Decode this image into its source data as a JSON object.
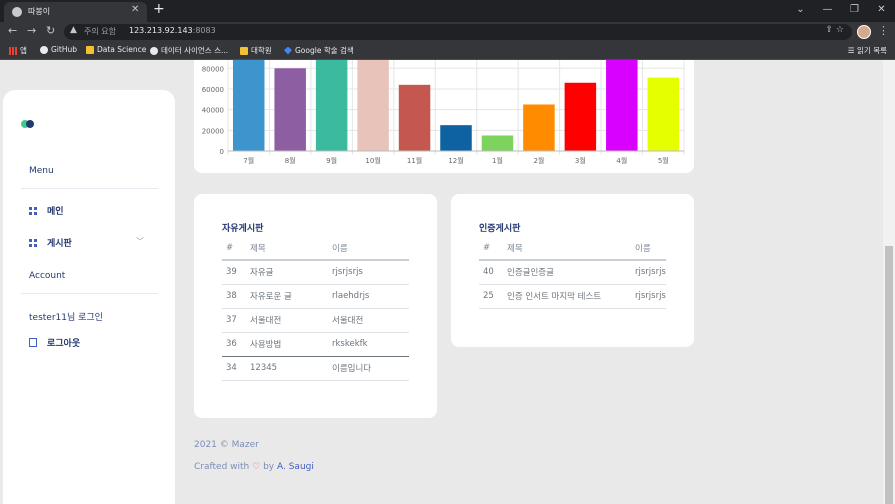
{
  "browser": {
    "tab_title": "따봉이",
    "tab_close": "✕",
    "new_tab": "+",
    "security_label": "주의 요함",
    "url_host": "123.213.92.143",
    "url_port": ":8083",
    "bookmarks": [
      "앱",
      "GitHub",
      "Data Science",
      "데이터 사이언스 스...",
      "대학원",
      "Google 학술 검색"
    ],
    "reading_list": "읽기 목록"
  },
  "sidebar": {
    "menu_title": "Menu",
    "items": [
      {
        "label": "메인"
      },
      {
        "label": "게시판"
      }
    ],
    "account_title": "Account",
    "login_text": "tester11님 로그인",
    "logout_label": "로그아웃"
  },
  "chart_data": {
    "type": "bar",
    "categories": [
      "7월",
      "8월",
      "9월",
      "10월",
      "11월",
      "12월",
      "1월",
      "2월",
      "3월",
      "4월",
      "5월"
    ],
    "values": [
      88000,
      80000,
      88000,
      88000,
      64000,
      25000,
      15000,
      45000,
      66000,
      88000,
      71000
    ],
    "colors": [
      "#3e95cd",
      "#8e5ea2",
      "#3cba9f",
      "#e8c3b9",
      "#c45850",
      "#0f62a1",
      "#7ed35e",
      "#ff8c00",
      "#ff0000",
      "#d800ff",
      "#e5ff00"
    ],
    "yticks": [
      0,
      20000,
      40000,
      60000,
      80000
    ],
    "ylim": [
      0,
      88000
    ],
    "grid": true
  },
  "free_board": {
    "title": "자유게시판",
    "headers": [
      "#",
      "제목",
      "이름"
    ],
    "rows": [
      [
        "39",
        "자유글",
        "rjsrjsrjs"
      ],
      [
        "38",
        "자유로운 글",
        "rlaehdrjs"
      ],
      [
        "37",
        "서울대전",
        "서울대전"
      ],
      [
        "36",
        "사용방법",
        "rkskekfk"
      ],
      [
        "34",
        "12345",
        "이름입니다"
      ]
    ]
  },
  "auth_board": {
    "title": "인증게시판",
    "headers": [
      "#",
      "제목",
      "이름"
    ],
    "rows": [
      [
        "40",
        "인증글인증글",
        "rjsrjsrjs"
      ],
      [
        "25",
        "인증 인서트 마지막 테스트",
        "rjsrjsrjs"
      ]
    ]
  },
  "footer": {
    "copyright": "2021 © Mazer",
    "crafted_prefix": "Crafted with",
    "heart": "♡",
    "by": "by",
    "author": "A. Saugi"
  }
}
